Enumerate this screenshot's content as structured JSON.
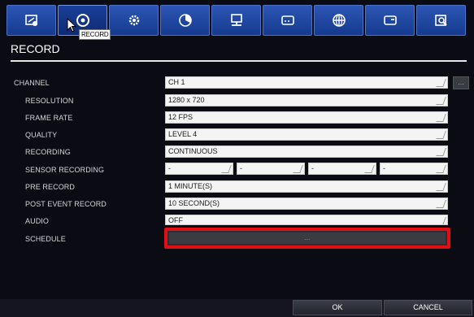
{
  "toolbar": {
    "tabs": [
      {
        "icon": "monitor-settings-icon"
      },
      {
        "icon": "record-icon"
      },
      {
        "icon": "gear-icon"
      },
      {
        "icon": "pie-icon"
      },
      {
        "icon": "network-icon"
      },
      {
        "icon": "storage-icon"
      },
      {
        "icon": "globe-icon"
      },
      {
        "icon": "device-icon"
      },
      {
        "icon": "search-icon"
      }
    ],
    "tooltip": "RECORD"
  },
  "page": {
    "title": "RECORD"
  },
  "channel": {
    "label": "CHANNEL",
    "value": "CH 1",
    "more": "..."
  },
  "rows": [
    {
      "label": "RESOLUTION",
      "value": "1280 x 720"
    },
    {
      "label": "FRAME RATE",
      "value": "12 FPS"
    },
    {
      "label": "QUALITY",
      "value": "LEVEL 4"
    },
    {
      "label": "RECORDING",
      "value": "CONTINUOUS"
    }
  ],
  "sensor": {
    "label": "SENSOR RECORDING",
    "values": [
      "-",
      "-",
      "-",
      "-"
    ]
  },
  "rows2": [
    {
      "label": "PRE RECORD",
      "value": "1 MINUTE(S)"
    },
    {
      "label": "POST EVENT RECORD",
      "value": "10 SECOND(S)"
    },
    {
      "label": "AUDIO",
      "value": "OFF"
    }
  ],
  "schedule": {
    "label": "SCHEDULE",
    "button": "..."
  },
  "footer": {
    "ok": "OK",
    "cancel": "CANCEL"
  },
  "colors": {
    "tab": "#2d56b4",
    "highlight": "#e10f14",
    "field": "#f4f4f4"
  }
}
